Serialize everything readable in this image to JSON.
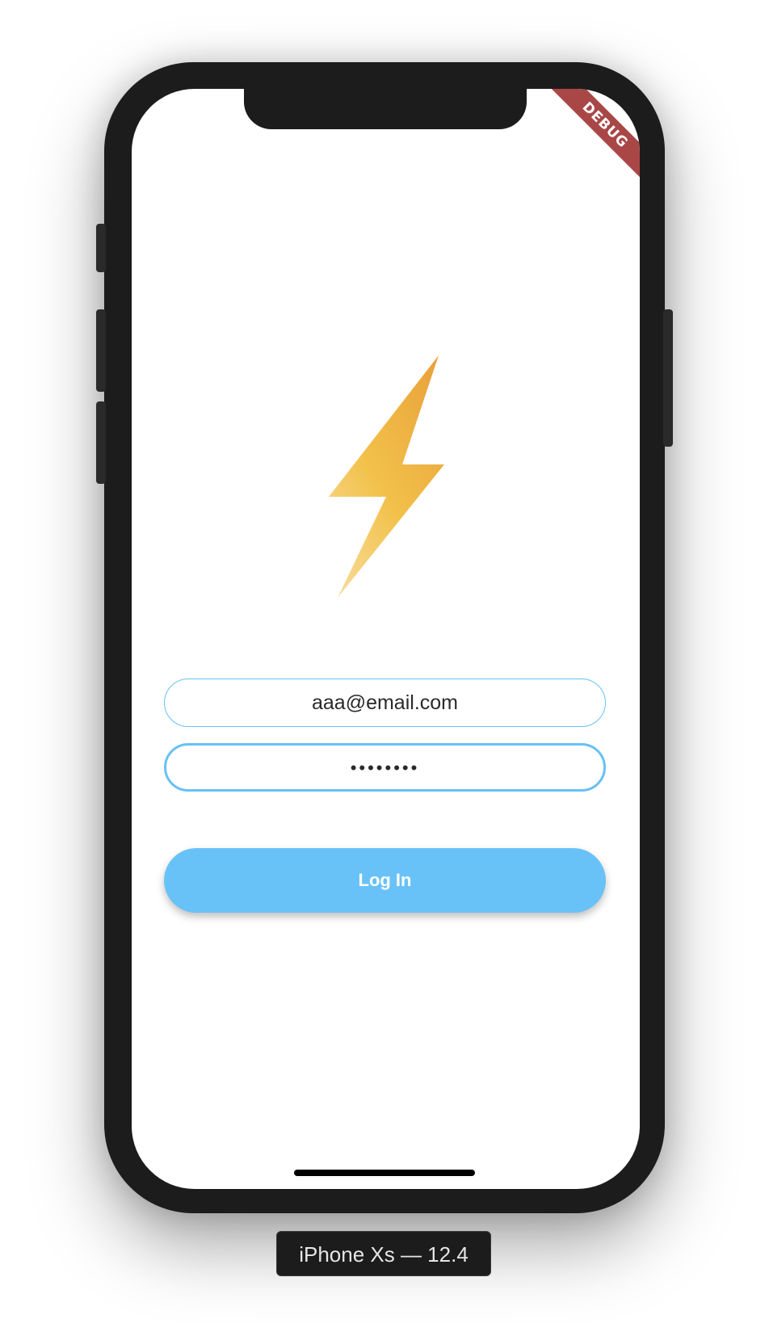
{
  "app": {
    "debug_banner": "DEBUG"
  },
  "login": {
    "logo_icon": "lightning-bolt-icon",
    "email_value": "aaa@email.com",
    "password_value": "••••••••",
    "login_button_label": "Log In"
  },
  "simulator": {
    "device_label": "iPhone Xs — 12.4"
  },
  "colors": {
    "accent": "#68c2f8",
    "field_border": "#67c1f5",
    "bolt_top": "#e9a23b",
    "bolt_mid": "#f2c14a",
    "bolt_bottom": "#f7dc9a",
    "debug_banner": "#a94747",
    "device_frame": "#1c1c1c"
  }
}
